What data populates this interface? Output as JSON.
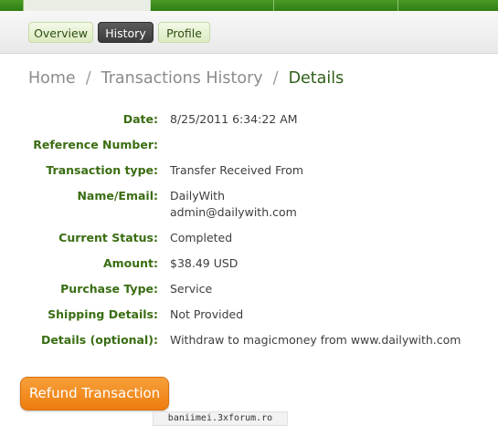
{
  "subtabs": [
    {
      "label": "Overview",
      "active": false
    },
    {
      "label": "History",
      "active": true
    },
    {
      "label": "Profile",
      "active": false
    }
  ],
  "breadcrumb": {
    "home": "Home",
    "separator": "/",
    "history": "Transactions History",
    "current": "Details"
  },
  "details": [
    {
      "label": "Date:",
      "value": "8/25/2011 6:34:22 AM"
    },
    {
      "label": "Reference Number:",
      "value": ""
    },
    {
      "label": "Transaction type:",
      "value": "Transfer Received From"
    },
    {
      "label": "Name/Email:",
      "value": "DailyWith",
      "value2": "admin@dailywith.com"
    },
    {
      "label": "Current Status:",
      "value": "Completed"
    },
    {
      "label": "Amount:",
      "value": "$38.49 USD"
    },
    {
      "label": "Purchase Type:",
      "value": "Service"
    },
    {
      "label": "Shipping Details:",
      "value": "Not Provided"
    },
    {
      "label": "Details (optional):",
      "value": "Withdraw to magicmoney from www.dailywith.com"
    }
  ],
  "actions": {
    "refund_label": "Refund Transaction"
  },
  "watermark": "baniimei.3xforum.ro",
  "colors": {
    "nav_green": "#3f8f1f",
    "label_green": "#3a6d12",
    "refund_orange": "#ee7c0e"
  }
}
